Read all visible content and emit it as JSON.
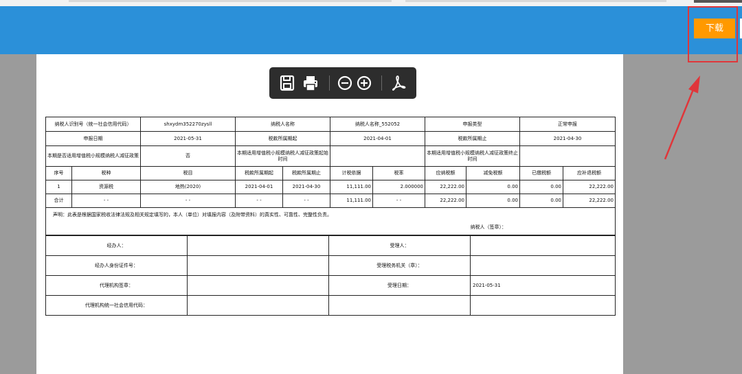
{
  "header": {
    "download_label": "下载"
  },
  "toolbar": {
    "buttons": [
      "save-icon",
      "print-icon",
      "zoom-out-icon",
      "zoom-in-icon",
      "pdf-icon"
    ]
  },
  "form": {
    "row1": {
      "taxpayer_id_label": "纳税人识别号（统一社会信用代码）",
      "taxpayer_id_value": "shxydm352270zysll",
      "taxpayer_name_label": "纳税人名称",
      "taxpayer_name_value": "纳税人名称_552052",
      "report_type_label": "申报类型",
      "report_type_value": "正常申报"
    },
    "row2": {
      "report_date_label": "申报日期",
      "report_date_value": "2021-05-31",
      "period_start_label": "税款所属期起",
      "period_start_value": "2021-04-01",
      "period_end_label": "税款所属期止",
      "period_end_value": "2021-04-30"
    },
    "row3": {
      "policy_label": "本期是否适用增值税小规模纳税人减征政策",
      "policy_value": "否",
      "policy_start_label": "本期适用增值税小规模纳税人减征政策起始时间",
      "policy_start_value": "",
      "policy_end_label": "本期适用增值税小规模纳税人减征政策终止时间",
      "policy_end_value": ""
    },
    "columns": [
      "序号",
      "税种",
      "税目",
      "税款所属期起",
      "税款所属期止",
      "计税依据",
      "税率",
      "应纳税额",
      "减免税额",
      "已缴税额",
      "应补退税额"
    ],
    "rows": [
      [
        "1",
        "资源税",
        "地热(2020)",
        "2021-04-01",
        "2021-04-30",
        "11,111.00",
        "2.000000",
        "22,222.00",
        "0.00",
        "0.00",
        "22,222.00"
      ],
      [
        "合计",
        "- -",
        "- -",
        "- -",
        "- -",
        "11,111.00",
        "- -",
        "22,222.00",
        "0.00",
        "0.00",
        "22,222.00"
      ]
    ],
    "declaration": "声明：此表是根据国家税收法律法规及相关规定填写的，本人（单位）对填报内容（及附带资料）的真实性、可靠性、完整性负责。",
    "declaration_sign": "纳税人（签章）：",
    "signature": {
      "handler_label": "经办人：",
      "handler_value": "",
      "handler_id_label": "经办人身份证件号：",
      "handler_id_value": "",
      "agent_seal_label": "代理机构签章：",
      "agent_seal_value": "",
      "agent_code_label": "代理机构统一社会信用代码：",
      "agent_code_value": "",
      "receiver_label": "受理人：",
      "receiver_value": "",
      "tax_office_label": "受理税务机关（章）：",
      "tax_office_value": "",
      "accept_date_label": "受理日期：",
      "accept_date_value": "2021-05-31",
      "blank_label": "",
      "blank_value": ""
    }
  },
  "colors": {
    "header_blue": "#2b90d9",
    "download_orange": "#ff9900",
    "highlight_red": "#e0363a",
    "viewer_gray": "#9b9b9b",
    "toolbar_dark": "#2d2d2d"
  }
}
